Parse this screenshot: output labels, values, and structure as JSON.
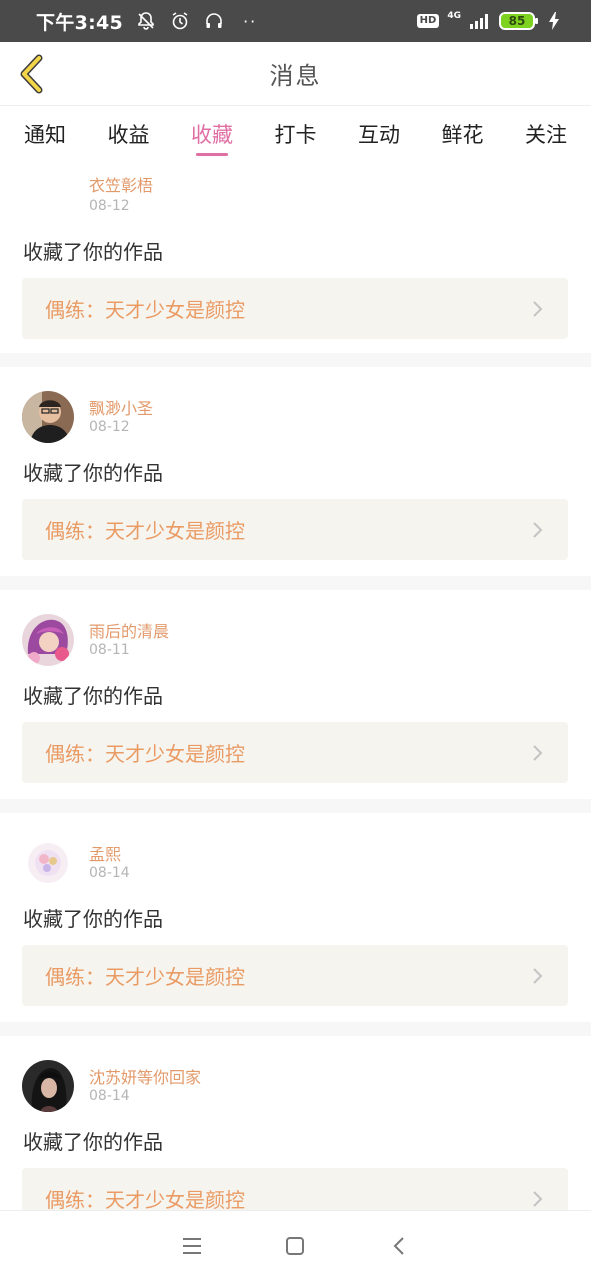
{
  "status_bar": {
    "time": "下午3:45",
    "dots": "··",
    "hd_label": "HD",
    "network_label": "4G",
    "battery_level": "85",
    "icons": [
      "bell-muted-icon",
      "alarm-icon",
      "headset-icon",
      "signal-icon",
      "charging-icon"
    ]
  },
  "header": {
    "title": "消息",
    "back_icon": "chevron-left-icon"
  },
  "tabs": [
    {
      "label": "通知",
      "active": false
    },
    {
      "label": "收益",
      "active": false
    },
    {
      "label": "收藏",
      "active": true
    },
    {
      "label": "打卡",
      "active": false
    },
    {
      "label": "互动",
      "active": false
    },
    {
      "label": "鲜花",
      "active": false
    },
    {
      "label": "关注",
      "active": false
    }
  ],
  "notifications": [
    {
      "username": "衣笠彰梧",
      "date": "08-12",
      "message": "收藏了你的作品",
      "work_title": "偶练：天才少女是颜控"
    },
    {
      "username": "飘渺小圣",
      "date": "08-12",
      "message": "收藏了你的作品",
      "work_title": "偶练：天才少女是颜控"
    },
    {
      "username": "雨后的清晨",
      "date": "08-11",
      "message": "收藏了你的作品",
      "work_title": "偶练：天才少女是颜控"
    },
    {
      "username": "孟熙",
      "date": "08-14",
      "message": "收藏了你的作品",
      "work_title": "偶练：天才少女是颜控"
    },
    {
      "username": "沈苏妍等你回家",
      "date": "08-14",
      "message": "收藏了你的作品",
      "work_title": "偶练：天才少女是颜控"
    }
  ],
  "colors": {
    "accent_pink": "#e06fa4",
    "username_orange": "#e39a6b",
    "work_title_orange": "#ea9b64",
    "back_chevron_yellow": "#f3d54a"
  },
  "nav_bar": {
    "icons": [
      "menu-icon",
      "home-square-icon",
      "back-triangle-icon"
    ]
  }
}
